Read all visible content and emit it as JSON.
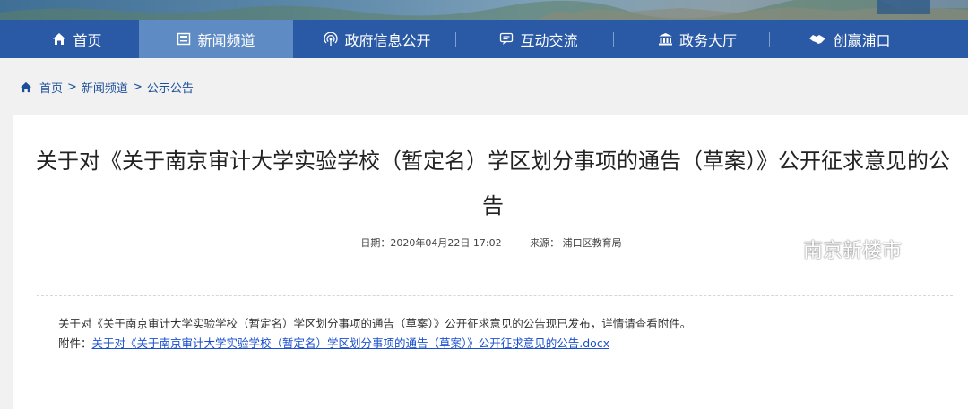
{
  "nav": {
    "items": [
      {
        "label": "首页",
        "icon": "home-icon",
        "active": false
      },
      {
        "label": "新闻频道",
        "icon": "news-icon",
        "active": true
      },
      {
        "label": "政府信息公开",
        "icon": "broadcast-icon",
        "active": false
      },
      {
        "label": "互动交流",
        "icon": "chat-icon",
        "active": false
      },
      {
        "label": "政务大厅",
        "icon": "building-icon",
        "active": false
      },
      {
        "label": "创赢浦口",
        "icon": "handshake-icon",
        "active": false
      }
    ]
  },
  "breadcrumb": {
    "items": [
      "首页",
      "新闻频道",
      "公示公告"
    ],
    "separator": ">"
  },
  "article": {
    "title": "关于对《关于南京审计大学实验学校（暂定名）学区划分事项的通告（草案）》公开征求意见的公告",
    "date": "日期：2020年04月22日 17:02",
    "source": "来源：  浦口区教育局",
    "body": "关于对《关于南京审计大学实验学校（暂定名）学区划分事项的通告（草案）》公开征求意见的公告现已发布，详情请查看附件。",
    "attachment_label": "附件：",
    "attachment_link": "关于对《关于南京审计大学实验学校（暂定名）学区划分事项的通告（草案）》公开征求意见的公告.docx"
  },
  "watermark": {
    "text": "南京新楼市",
    "icon": "wechat-icon"
  },
  "colors": {
    "nav_bg": "#2a5aa5",
    "nav_active": "#5f8bc4",
    "link": "#1a4fcf",
    "breadcrumb": "#1d4f99"
  }
}
